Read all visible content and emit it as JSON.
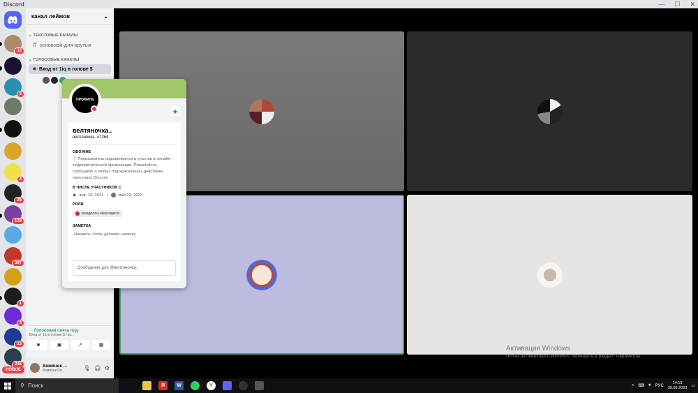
{
  "window": {
    "title": "Discord"
  },
  "guilds": [
    {
      "badge": ""
    },
    {
      "badge": "13"
    },
    {
      "badge": ""
    },
    {
      "badge": "6"
    },
    {
      "badge": ""
    },
    {
      "badge": ""
    },
    {
      "badge": ""
    },
    {
      "badge": "4"
    },
    {
      "badge": "26"
    },
    {
      "badge": "176"
    },
    {
      "badge": ""
    },
    {
      "badge": "397"
    },
    {
      "badge": ""
    },
    {
      "badge": "1"
    },
    {
      "badge": "3"
    },
    {
      "badge": "13"
    },
    {
      "badge": "245"
    }
  ],
  "guild_new_label": "НОВОЕ",
  "server": {
    "name": "канал леймов"
  },
  "categories": {
    "text": "ТЕКСТОВЫЕ КАНАЛЫ",
    "voice": "ГОЛОСОВЫЕ КАНАЛЫ"
  },
  "channels": {
    "text_channel": "основной-для-крутых",
    "voice_channel": "Вход от 1iq в голове $"
  },
  "voice_panel": {
    "status": "Голосовая связь под",
    "sub": "Вход от 1iq в голове $ / ка..."
  },
  "user": {
    "name": "Хомячок ...",
    "sub": "Хомячок Оп..."
  },
  "profile": {
    "avatar_text": "ПРОФИЛЬ",
    "display_name": "велтяночка..",
    "tag": "велтяночка..#7264",
    "about_heading": "ОБО МНЕ",
    "about_text": "ⓘ Пользователь подозревается в участии в онлайн-террористической организации. Пожалуйста, сообщайте о любых подозрительных действиях персоналу Discord.",
    "member_since_heading": "В ЧИСЛЕ УЧАСТНИКОВ С",
    "discord_since": "янв. 16, 2021",
    "server_since": "май 23, 2023",
    "roles_heading": "РОЛИ",
    "role": "владелец мерседеса",
    "note_heading": "ЗАМЕТКА",
    "note_placeholder": "Нажмите, чтобы добавить заметку",
    "message_placeholder": "Сообщение для @велтяночка.."
  },
  "watermark": {
    "title": "Активация Windows",
    "text": "Чтобы активировать Windows, перейдите в раздел \"Параметры\"."
  },
  "taskbar": {
    "search_label": "Поиск",
    "lang": "РУС",
    "time": "14:13",
    "date": "30.05.2023"
  },
  "colors": {
    "accent": "#5865f2",
    "online_green": "#23a559",
    "dnd_red": "#ed4245",
    "banner": "#a1c76a",
    "speaking_border": "#3ba55c"
  }
}
